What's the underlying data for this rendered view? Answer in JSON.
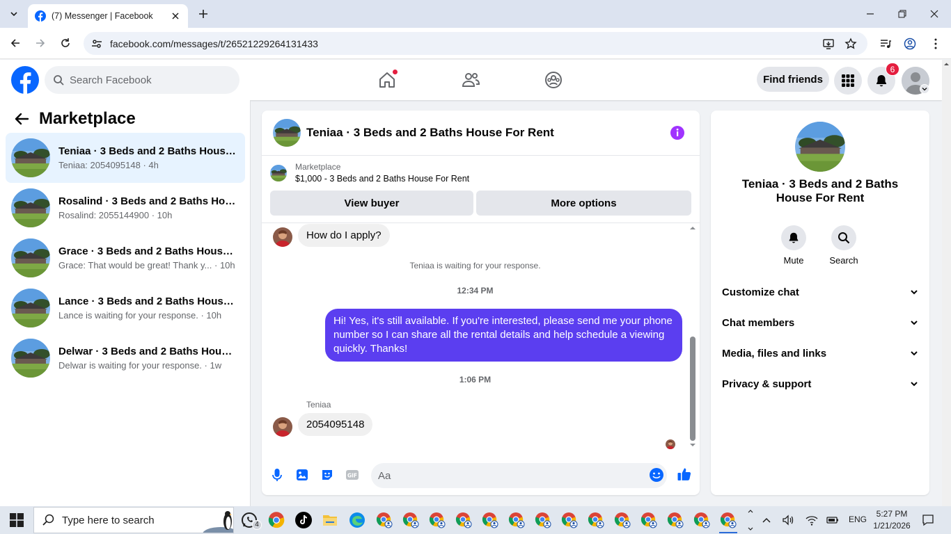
{
  "browser": {
    "tab_title": "(7) Messenger | Facebook",
    "url": "facebook.com/messages/t/26521229264131433"
  },
  "fb_header": {
    "search_placeholder": "Search Facebook",
    "find_friends": "Find friends",
    "notifications_count": "6"
  },
  "sidebar": {
    "title": "Marketplace",
    "conversations": [
      {
        "name": "Teniaa · 3 Beds and 2 Baths House ...",
        "preview": "Teniaa: 2054095148 · 4h",
        "active": true
      },
      {
        "name": "Rosalind · 3 Beds and 2 Baths Hou...",
        "preview": "Rosalind: 2055144900 · 10h",
        "active": false
      },
      {
        "name": "Grace · 3 Beds and 2 Baths House ...",
        "preview": "Grace: That would be great! Thank y... · 10h",
        "active": false
      },
      {
        "name": "Lance · 3 Beds and 2 Baths House ...",
        "preview": "Lance is waiting for your response. · 10h",
        "active": false
      },
      {
        "name": "Delwar · 3 Beds and 2 Baths House...",
        "preview": "Delwar is waiting for your response. · 1w",
        "active": false
      }
    ]
  },
  "chat": {
    "title": "Teniaa · 3 Beds and 2 Baths House For Rent",
    "marketplace_label": "Marketplace",
    "listing": "$1,000 - 3 Beds and 2 Baths House For Rent",
    "view_buyer": "View buyer",
    "more_options": "More options",
    "messages": {
      "incoming_1": "How do I apply?",
      "waiting_notice": "Teniaa is waiting for your response.",
      "time_1": "12:34 PM",
      "outgoing_1": "Hi! Yes, it's still available. If you're interested, please send me your phone number so I can share all the rental details and help schedule a viewing quickly. Thanks!",
      "time_2": "1:06 PM",
      "sender_name": "Teniaa",
      "incoming_2": "2054095148"
    },
    "composer_placeholder": "Aa",
    "accent_color": "#5b3ef0"
  },
  "info_panel": {
    "name": "Teniaa · 3 Beds and 2 Baths House For Rent",
    "actions": [
      "Mute",
      "Search"
    ],
    "sections": [
      "Customize chat",
      "Chat members",
      "Media, files and links",
      "Privacy & support"
    ]
  },
  "taskbar": {
    "search_placeholder": "Type here to search",
    "whatsapp_badge": "4",
    "language": "ENG",
    "time": "5:27 PM",
    "date": "1/21/2026"
  },
  "colors": {
    "fb_blue": "#0866ff",
    "messenger_purple": "#a033ff",
    "badge_red": "#e41e3f"
  }
}
